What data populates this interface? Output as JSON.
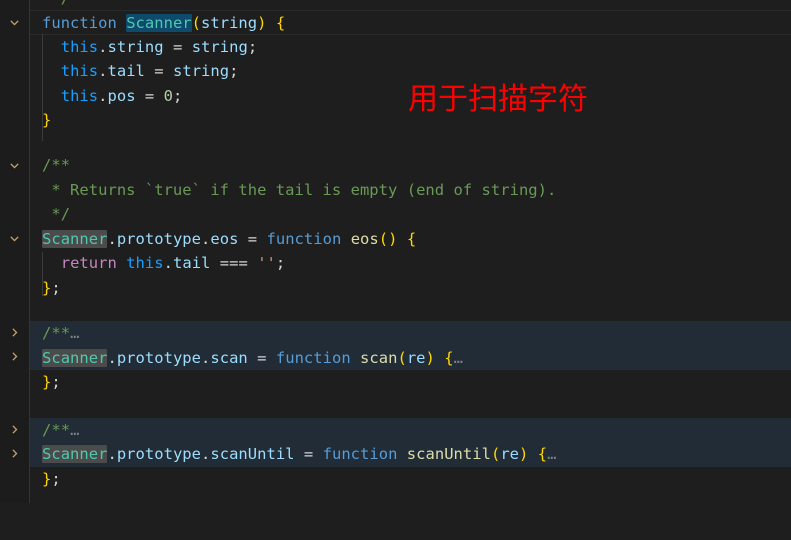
{
  "editor": {
    "theme": "dark-plus",
    "background": "#1e1e1e",
    "gutter_background": "#1c1c1c",
    "folded_line_background": "#212c37",
    "occurrence_highlight": "#4b4b4b",
    "selection_highlight": "#0d4a6b",
    "annotation_color": "#ff0000"
  },
  "annotation": {
    "text": "用于扫描字符"
  },
  "fold_controls": [
    {
      "state": "expanded",
      "glyph": "chevron-down"
    },
    {
      "state": "expanded",
      "glyph": "chevron-down"
    },
    {
      "state": "expanded",
      "glyph": "chevron-down"
    },
    {
      "state": "collapsed",
      "glyph": "chevron-right"
    },
    {
      "state": "collapsed",
      "glyph": "chevron-right"
    },
    {
      "state": "collapsed",
      "glyph": "chevron-right"
    },
    {
      "state": "collapsed",
      "glyph": "chevron-right"
    }
  ],
  "code_lines": [
    {
      "text": " */"
    },
    {
      "text": "function Scanner(string) {"
    },
    {
      "text": "  this.string = string;"
    },
    {
      "text": "  this.tail = string;"
    },
    {
      "text": "  this.pos = 0;"
    },
    {
      "text": "}"
    },
    {
      "text": ""
    },
    {
      "text": "/**"
    },
    {
      "text": " * Returns `true` if the tail is empty (end of string)."
    },
    {
      "text": " */"
    },
    {
      "text": "Scanner.prototype.eos = function eos() {"
    },
    {
      "text": "  return this.tail === '';"
    },
    {
      "text": "};"
    },
    {
      "text": ""
    },
    {
      "text": "/** …"
    },
    {
      "text": "Scanner.prototype.scan = function scan(re) { …"
    },
    {
      "text": "};"
    },
    {
      "text": ""
    },
    {
      "text": "/** …"
    },
    {
      "text": "Scanner.prototype.scanUntil = function scanUntil(re) { …"
    },
    {
      "text": "};"
    }
  ],
  "tokens": {
    "kw_function": "function",
    "kw_return": "return",
    "ident_this": "this",
    "ident_string": "string",
    "ident_tail": "tail",
    "ident_pos": "pos",
    "ident_re": "re",
    "type_scanner": "Scanner",
    "prop_prototype": "prototype",
    "prop_eos": "eos",
    "prop_scan": "scan",
    "prop_scanUntil": "scanUntil",
    "fn_eos": "eos",
    "fn_scan": "scan",
    "fn_scanUntil": "scanUntil",
    "num_zero": "0",
    "str_empty": "''",
    "op_assign": "=",
    "op_strict_eq": "===",
    "comment_open": "/**",
    "comment_close": " */",
    "comment_body": " * Returns `true` if the tail is empty (end of string).",
    "comment_folded": "/**",
    "ellipsis": "…",
    "brace_open": "{",
    "brace_close": "}",
    "brace_close_semi": "};",
    "paren_open": "(",
    "paren_close": ")",
    "semi": ";",
    "dot": ".",
    "slash": " */"
  }
}
